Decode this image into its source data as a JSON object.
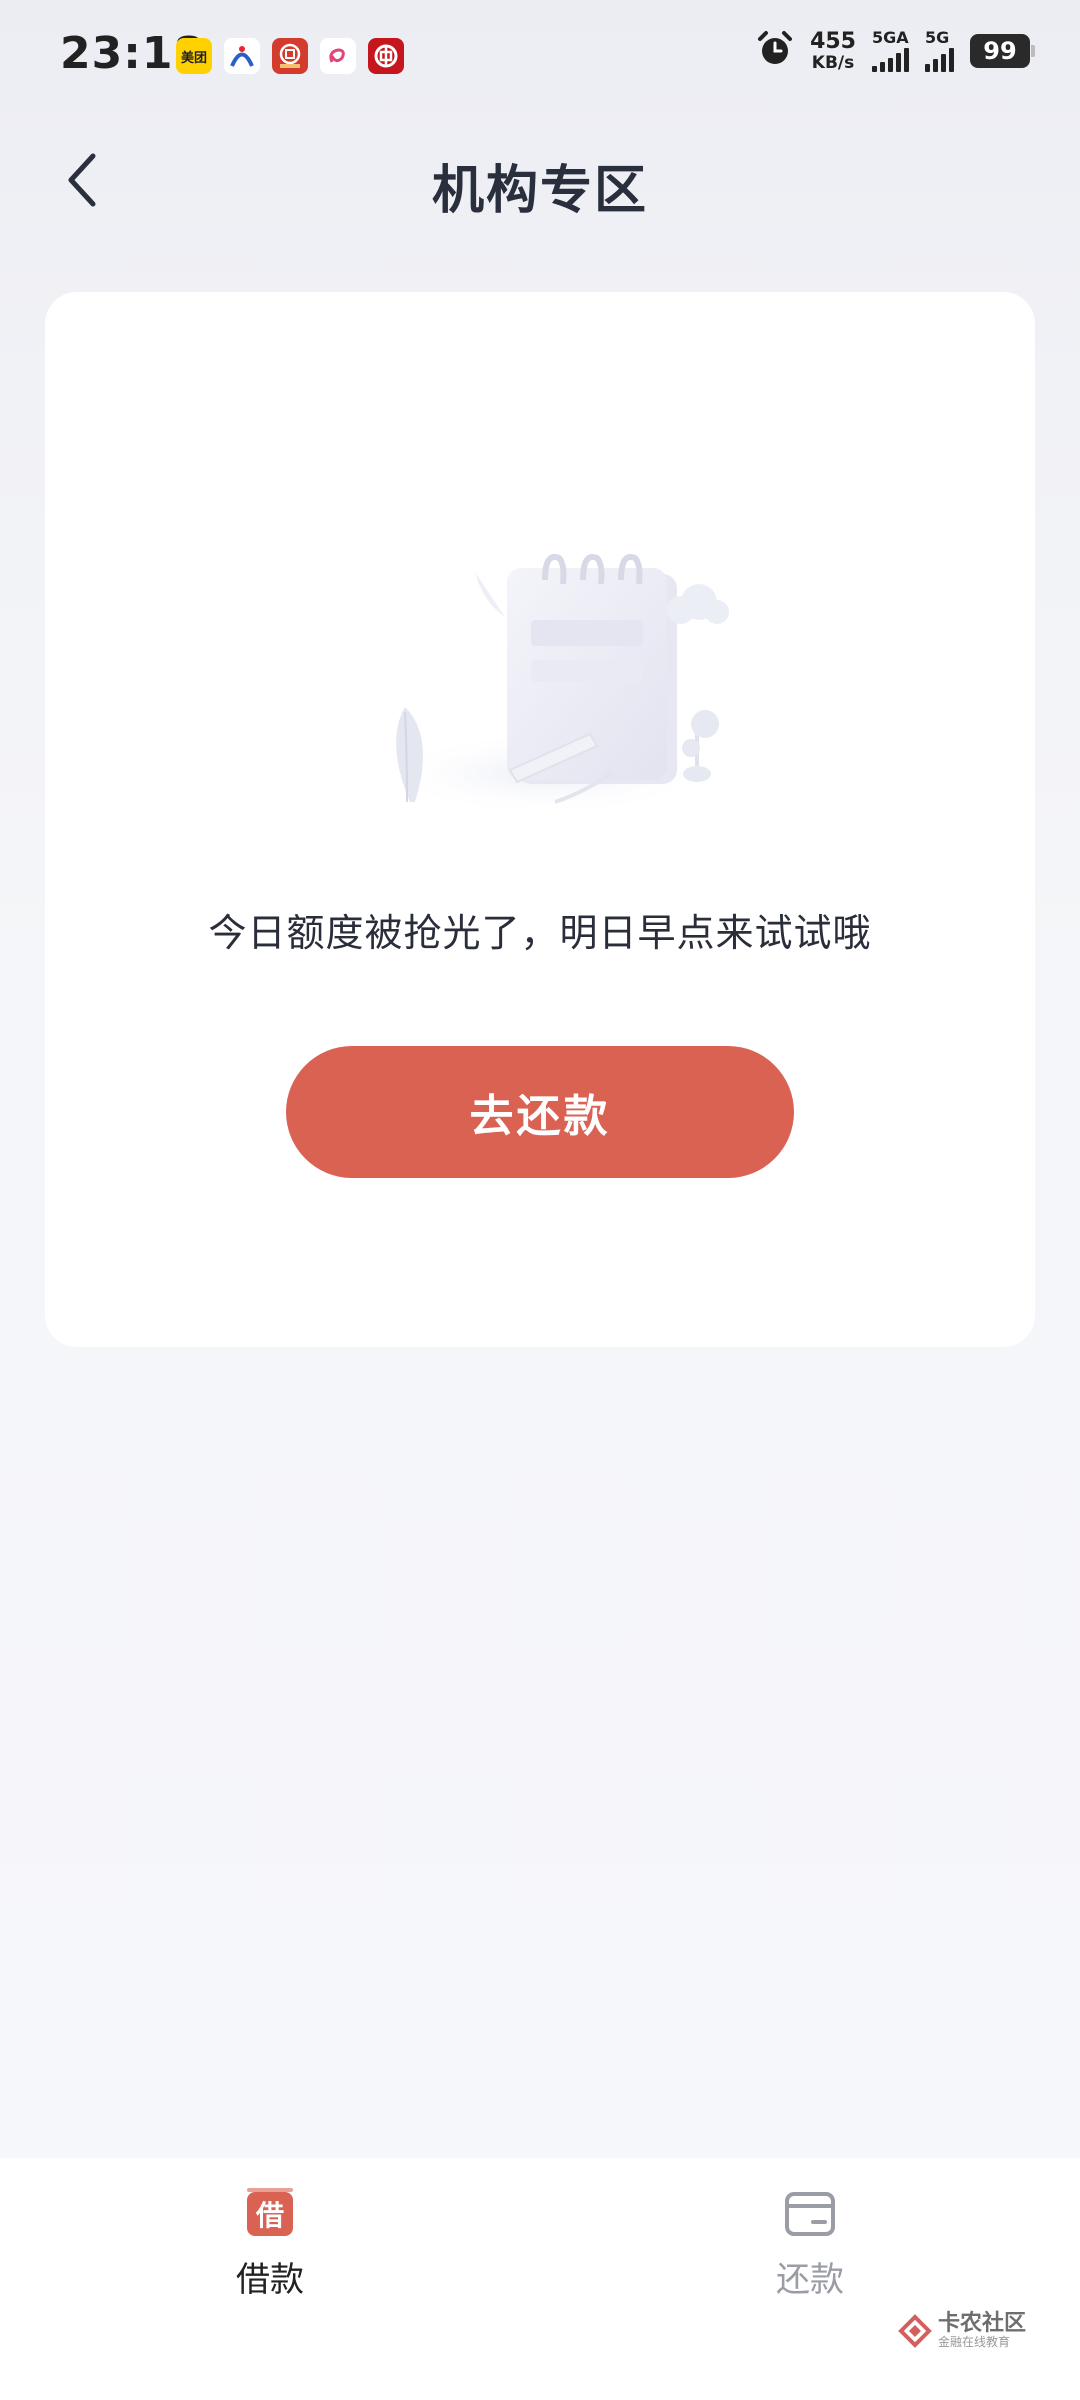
{
  "status_bar": {
    "time": "23:18",
    "app_icons": [
      {
        "name": "meituan-icon",
        "label": "美团",
        "bg": "#ffd100",
        "fg": "#222"
      },
      {
        "name": "blue-arc-app-icon",
        "label": "",
        "bg": "#ffffff",
        "fg": "#2b5ec8"
      },
      {
        "name": "red-bank-app-icon",
        "label": "",
        "bg": "#d33b2f",
        "fg": "#fff"
      },
      {
        "name": "pink-swirl-app-icon",
        "label": "",
        "bg": "#ffffff",
        "fg": "#e0457b"
      },
      {
        "name": "bank-of-china-icon",
        "label": "",
        "bg": "#c4161c",
        "fg": "#fff"
      }
    ],
    "net_speed_value": "455",
    "net_speed_unit": "KB/s",
    "signal_1_label": "5GA",
    "signal_2_label": "5G",
    "battery": "99"
  },
  "header": {
    "title": "机构专区"
  },
  "card": {
    "message": "今日额度被抢光了，明日早点来试试哦",
    "button_label": "去还款"
  },
  "bottom_nav": {
    "items": [
      {
        "label": "借款",
        "icon_text": "借",
        "active": true
      },
      {
        "label": "还款",
        "active": false
      }
    ]
  },
  "watermark": {
    "name": "卡农社区",
    "sub": "金融在线教育"
  },
  "colors": {
    "accent": "#d96253",
    "title": "#2a2f3d",
    "inactive": "#9a9da6"
  }
}
